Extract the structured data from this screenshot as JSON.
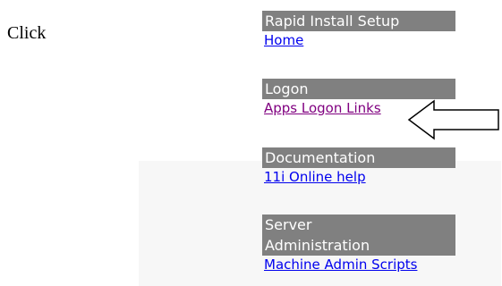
{
  "instruction": {
    "text": "Click"
  },
  "menu": {
    "sections": [
      {
        "header": "Rapid Install Setup",
        "link": "Home"
      },
      {
        "header": "Logon",
        "link": "Apps Logon Links"
      },
      {
        "header": "Documentation",
        "link": "11i Online help"
      },
      {
        "header_line1": "Server",
        "header_line2": "Administration",
        "link": "Machine Admin Scripts"
      }
    ]
  },
  "colors": {
    "header_bg": "#808080",
    "header_text": "#ffffff",
    "link": "#0000ee",
    "visited_link": "#800080"
  },
  "icons": {
    "pointer": "left-arrow-icon"
  }
}
